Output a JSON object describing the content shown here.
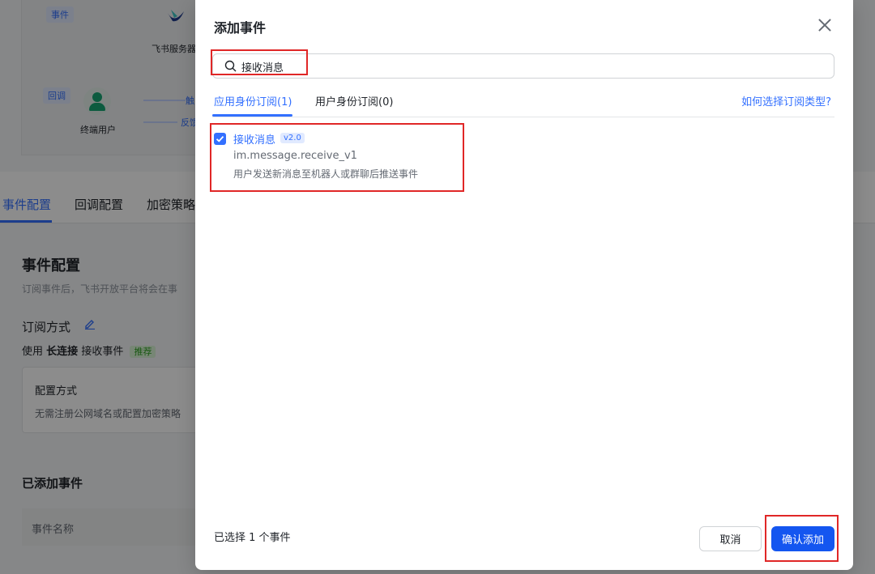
{
  "background": {
    "diagram": {
      "event_tag": "事件",
      "callback_tag": "回调",
      "server_label": "飞书服务器",
      "user_label": "终端用户",
      "trigger_text": "触",
      "feedback_text": "反馈"
    },
    "tabs": [
      "事件配置",
      "回调配置",
      "加密策略"
    ],
    "section_title": "事件配置",
    "section_desc": "订阅事件后，飞书开放平台将会在事",
    "subscribe_title": "订阅方式",
    "subscribe_line_prefix": "使用",
    "subscribe_line_bold": "长连接",
    "subscribe_line_suffix": "接收事件",
    "recommend_badge": "推荐",
    "config_card_title": "配置方式",
    "config_card_text": "无需注册公网域名或配置加密策略",
    "added_title": "已添加事件",
    "table_header": "事件名称"
  },
  "modal": {
    "title": "添加事件",
    "search": {
      "value": "接收消息"
    },
    "tabs": [
      {
        "label": "应用身份订阅(1)"
      },
      {
        "label": "用户身份订阅(0)"
      }
    ],
    "help_link": "如何选择订阅类型?",
    "events": [
      {
        "name": "接收消息",
        "version": "v2.0",
        "id": "im.message.receive_v1",
        "description": "用户发送新消息至机器人或群聊后推送事件",
        "checked": true
      }
    ],
    "footer": {
      "status": "已选择 1 个事件",
      "cancel": "取消",
      "confirm": "确认添加"
    }
  },
  "colors": {
    "accent": "#3370ff",
    "primary_button": "#1456f0",
    "highlight": "#e02727"
  }
}
